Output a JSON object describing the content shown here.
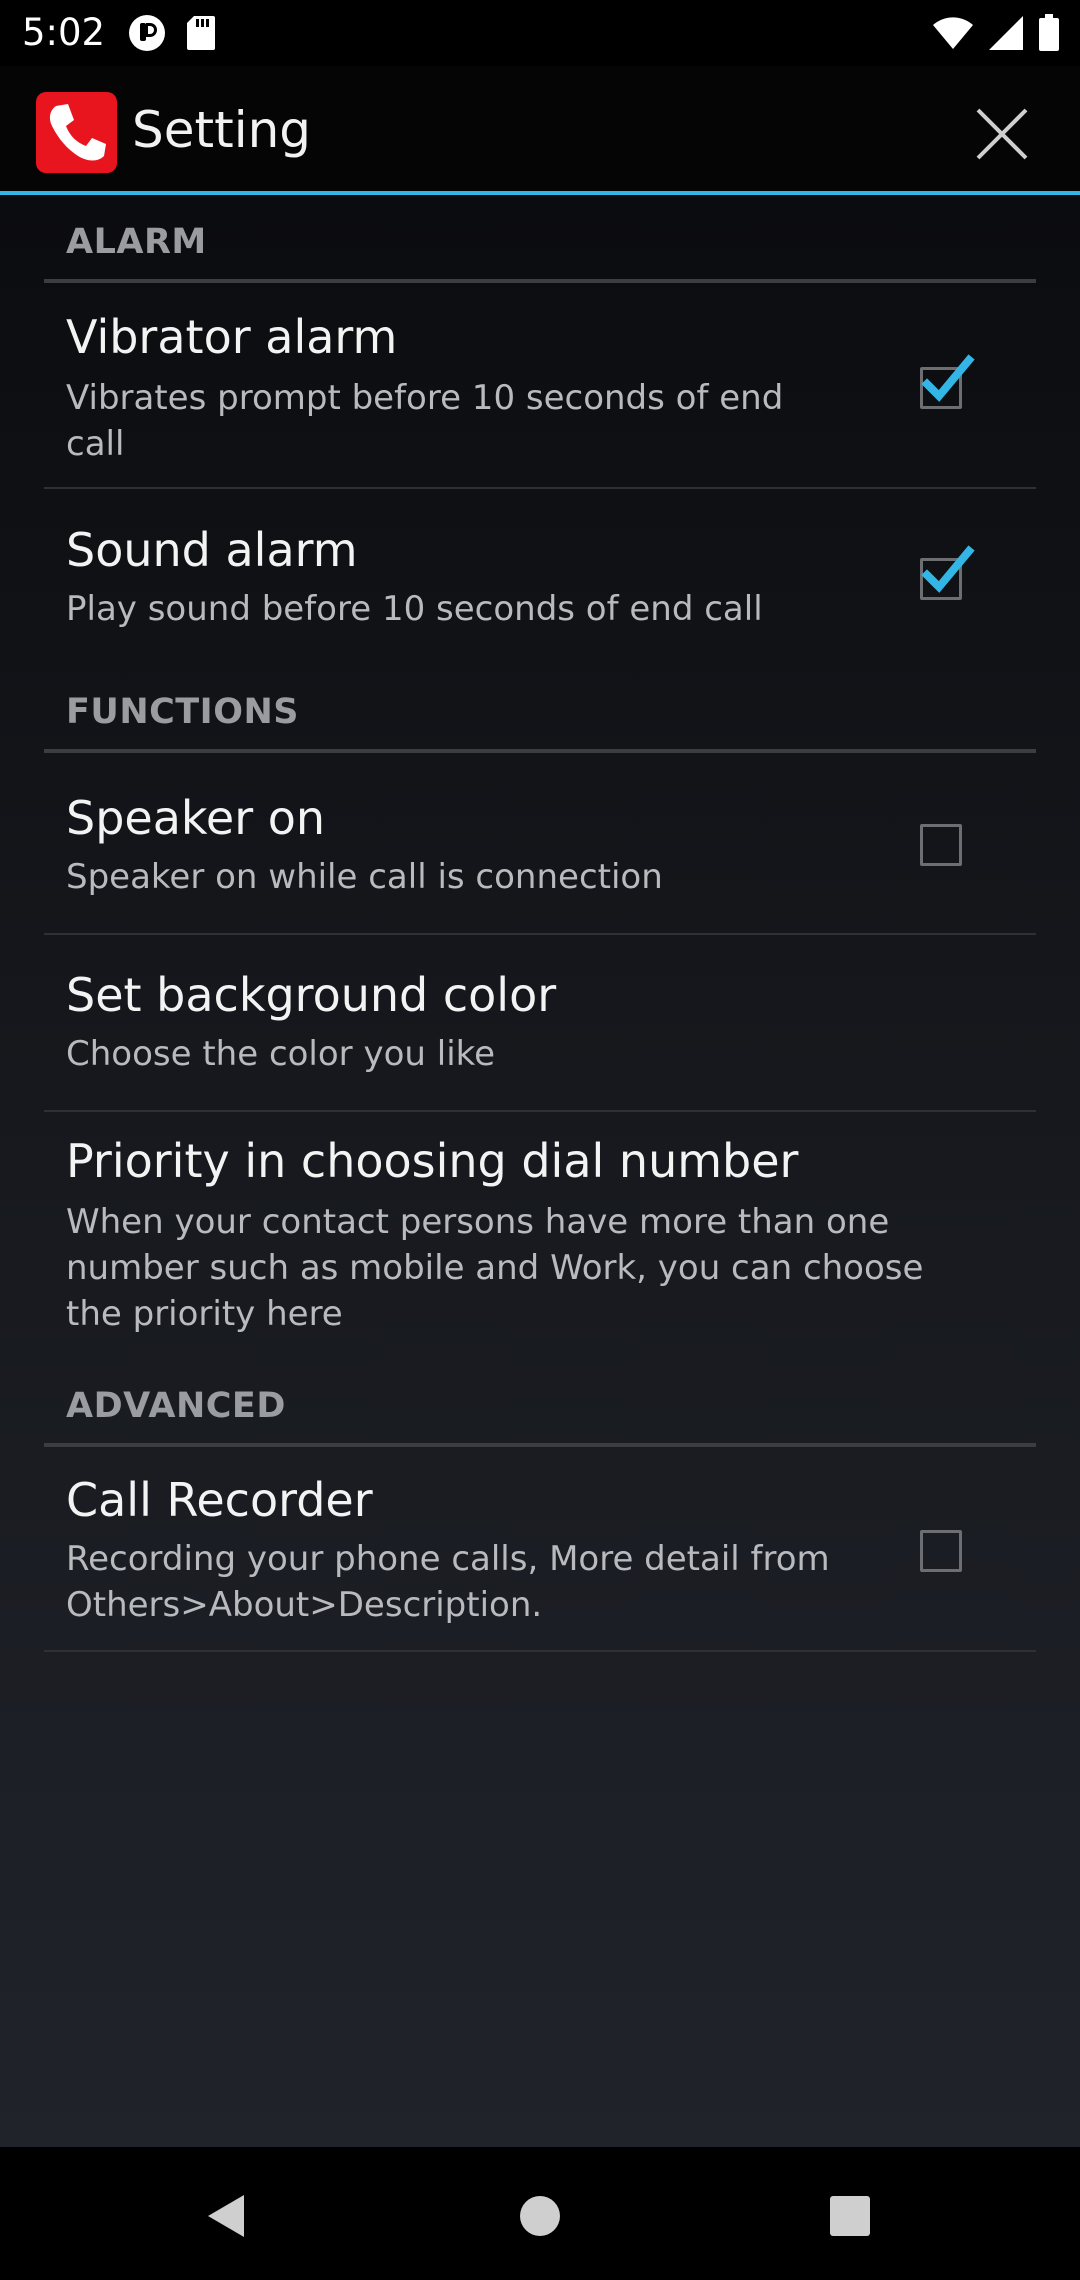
{
  "status_bar": {
    "time": "5:02",
    "left_icons": [
      "notification-app-icon",
      "sd-card-icon"
    ],
    "right_icons": [
      "wifi-icon",
      "cell-signal-icon",
      "battery-icon"
    ]
  },
  "app_bar": {
    "title": "Setting",
    "app_icon": "phone-handset-icon",
    "close_icon": "close-icon"
  },
  "colors": {
    "accent": "#33b5e5",
    "app_icon_red": "#e8141e",
    "check_blue": "#33b5e5"
  },
  "sections": [
    {
      "header": "ALARM",
      "items": [
        {
          "title": "Vibrator alarm",
          "summary": "Vibrates prompt before 10 seconds of end call",
          "has_checkbox": true,
          "checked": true
        },
        {
          "title": "Sound alarm",
          "summary": "Play sound before 10 seconds of end call",
          "has_checkbox": true,
          "checked": true
        }
      ]
    },
    {
      "header": "FUNCTIONS",
      "items": [
        {
          "title": "Speaker on",
          "summary": "Speaker on while call is connection",
          "has_checkbox": true,
          "checked": false
        },
        {
          "title": "Set background color",
          "summary": "Choose the color you like",
          "has_checkbox": false
        },
        {
          "title": "Priority in choosing dial number",
          "summary": "When your contact persons have more than one number such as mobile and Work, you can choose the priority here",
          "has_checkbox": false
        }
      ]
    },
    {
      "header": "ADVANCED",
      "items": [
        {
          "title": "Call Recorder",
          "summary": "Recording your phone calls, More detail from Others>About>Description.",
          "has_checkbox": true,
          "checked": false
        }
      ]
    }
  ],
  "nav_bar": {
    "buttons": [
      "back-icon",
      "home-icon",
      "recents-icon"
    ]
  }
}
